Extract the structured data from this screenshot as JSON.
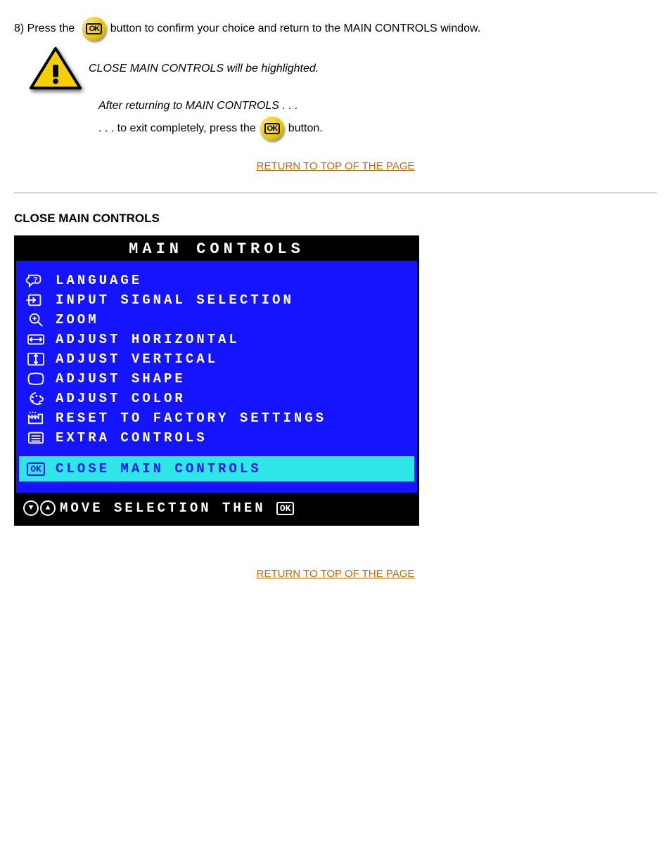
{
  "step8": {
    "label": "8) Press the ",
    "after_btn": " button to confirm your choice and return to the MAIN CONTROLS window."
  },
  "warning": {
    "text": "CLOSE MAIN CONTROLS will be highlighted."
  },
  "after": {
    "text": "After returning to MAIN CONTROLS . . ."
  },
  "step9": {
    "before_btn": ". . . to exit completely, press the ",
    "after_btn": " button."
  },
  "back_link": "RETURN TO TOP OF THE PAGE",
  "close_heading": "CLOSE MAIN CONTROLS",
  "osd": {
    "title": "MAIN CONTROLS",
    "items": [
      {
        "icon": "speech-question",
        "label": "LANGUAGE"
      },
      {
        "icon": "input-arrow",
        "label": "INPUT SIGNAL SELECTION"
      },
      {
        "icon": "magnify-plus",
        "label": "ZOOM"
      },
      {
        "icon": "arrows-h",
        "label": "ADJUST HORIZONTAL"
      },
      {
        "icon": "arrows-v",
        "label": "ADJUST VERTICAL"
      },
      {
        "icon": "shape",
        "label": "ADJUST SHAPE"
      },
      {
        "icon": "palette",
        "label": "ADJUST COLOR"
      },
      {
        "icon": "factory",
        "label": "RESET TO FACTORY SETTINGS"
      },
      {
        "icon": "list",
        "label": "EXTRA CONTROLS"
      }
    ],
    "highlight": {
      "icon": "ok-box",
      "label": "CLOSE MAIN CONTROLS"
    },
    "footer": {
      "text": "MOVE SELECTION THEN"
    }
  }
}
